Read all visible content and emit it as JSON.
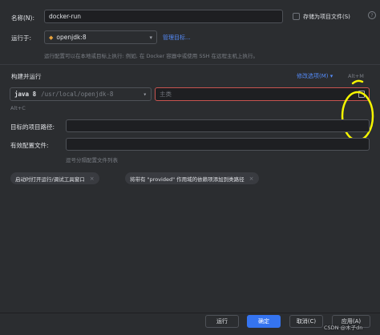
{
  "colors": {
    "background": "#2b2d30",
    "input_bg": "#1e1f22",
    "accent": "#3574f0",
    "link": "#548af7",
    "error": "#c75450",
    "highlight": "#f5f500"
  },
  "header": {
    "name_label": "名称(N):",
    "name_value": "docker-run",
    "store_label": "存储为项目文件(S)",
    "help_icon": "gear-icon"
  },
  "run_on": {
    "label": "运行于:",
    "selected": "openjdk:8",
    "manage_link": "管理目标...",
    "description": "运行配置可以在本地或目标上执行: 例如, 在 Docker 容器中或使用 SSH 在远程主机上执行。"
  },
  "build_run": {
    "section_title": "构建并运行",
    "modify_options": "修改选项(M)",
    "modify_shortcut": "Alt+M",
    "jdk_bold": "java 8",
    "jdk_path": "/usr/local/openjdk-8",
    "main_class_placeholder": "主类",
    "alt_c": "Alt+C"
  },
  "fields": {
    "target_path_label": "目标的项目路径:",
    "target_path_value": "",
    "active_profiles_label": "有效配置文件:",
    "active_profiles_value": "",
    "profiles_hint": "逗号分隔配置文件列表"
  },
  "chips": [
    {
      "label": "启动时打开运行/调试工具窗口"
    },
    {
      "label": "将带有 \"provided\" 作用域的依赖项添加到类路径"
    }
  ],
  "footer": {
    "run": "运行",
    "ok": "确定",
    "cancel": "取消(C)",
    "apply": "应用(A)",
    "watermark": "CSDN @木子dn"
  }
}
